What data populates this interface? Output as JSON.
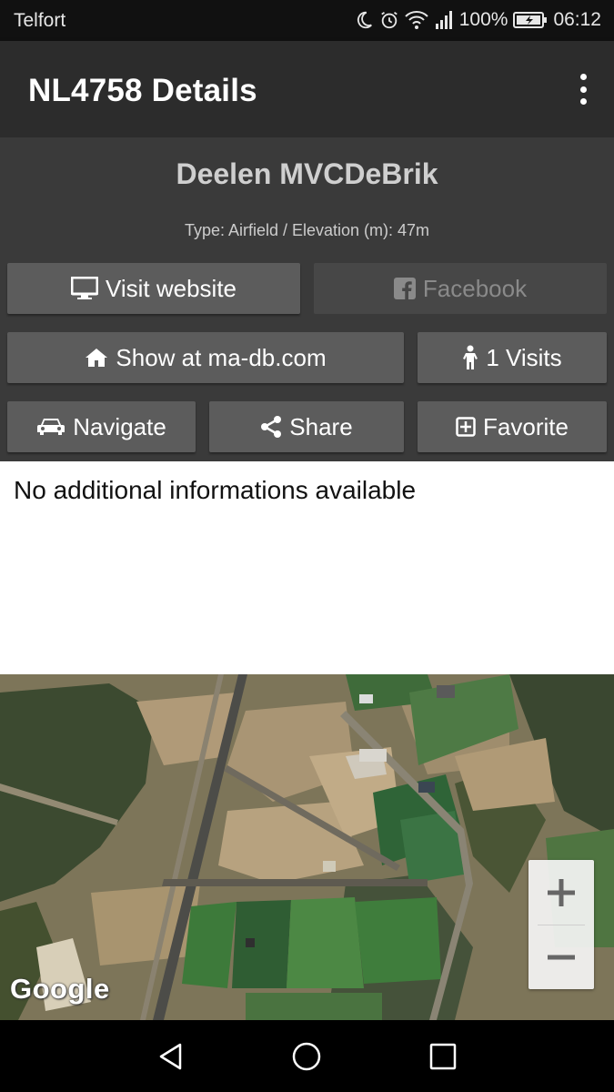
{
  "status_bar": {
    "carrier": "Telfort",
    "battery": "100%",
    "time": "06:12"
  },
  "app_bar": {
    "title": "NL4758 Details"
  },
  "airfield": {
    "name": "Deelen MVCDeBrik",
    "meta": "Type: Airfield / Elevation (m): 47m"
  },
  "buttons": {
    "visit_website": "Visit website",
    "facebook": "Facebook",
    "show_at": "Show at ma-db.com",
    "visits": "1 Visits",
    "navigate": "Navigate",
    "share": "Share",
    "favorite": "Favorite"
  },
  "info": {
    "text": "No additional informations available"
  },
  "map": {
    "logo": "Google",
    "zoom_in": "+",
    "zoom_out": "−"
  },
  "icons": [
    "moon-icon",
    "alarm-icon",
    "wifi-icon",
    "signal-icon",
    "battery-icon",
    "overflow-menu-icon",
    "monitor-icon",
    "facebook-icon",
    "home-icon",
    "person-icon",
    "car-icon",
    "share-icon",
    "plus-square-icon",
    "back-icon",
    "home-circle-icon",
    "recents-icon"
  ],
  "colors": {
    "app_bar": "#2c2c2c",
    "details_bg": "#3a3a3a",
    "button": "#5c5c5c",
    "button_disabled": "#474747"
  }
}
